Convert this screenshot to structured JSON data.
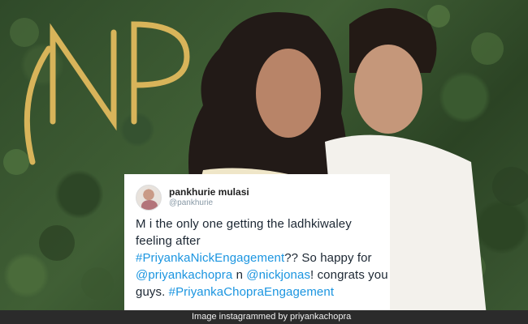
{
  "tweet": {
    "display_name": "pankhurie mulasi",
    "handle": "@pankhurie",
    "lines": [
      [
        {
          "t": "M i the only one getting the ladhkiwaley",
          "tag": false
        }
      ],
      [
        {
          "t": "feeling after",
          "tag": false
        }
      ],
      [
        {
          "t": "#PriyankaNickEngagement",
          "tag": true
        },
        {
          "t": "?? So happy for",
          "tag": false
        }
      ],
      [
        {
          "t": "@priyankachopra",
          "tag": true
        },
        {
          "t": " n ",
          "tag": false
        },
        {
          "t": "@nickjonas",
          "tag": true
        },
        {
          "t": "! congrats you",
          "tag": false
        }
      ],
      [
        {
          "t": "guys. ",
          "tag": false
        },
        {
          "t": "#PriyankaChopraEngagement",
          "tag": true
        }
      ]
    ]
  },
  "credit": "Image instagrammed by priyankachopra",
  "colors": {
    "link": "#1b95e0",
    "foliage": "#2f4a29",
    "gold": "#d8b45a",
    "caption_bg": "#2b2b2b"
  }
}
